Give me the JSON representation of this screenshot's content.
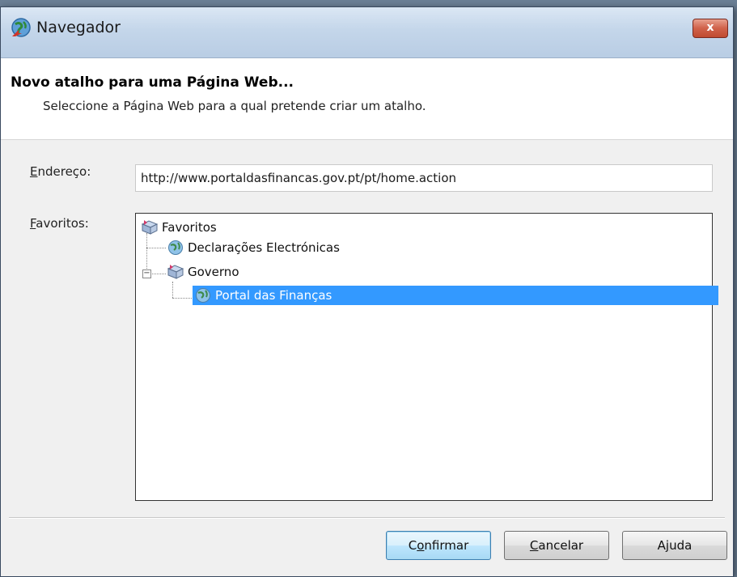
{
  "window": {
    "title": "Navegador",
    "close_label": "x"
  },
  "header": {
    "title": "Novo atalho para uma Página Web...",
    "subtitle": "Seleccione a Página Web para a qual pretende criar um atalho."
  },
  "form": {
    "address_label_prefix": "E",
    "address_label_rest": "ndereço:",
    "address_value": "http://www.portaldasfinancas.gov.pt/pt/home.action",
    "favorites_label_prefix": "F",
    "favorites_label_rest": "avoritos:"
  },
  "tree": {
    "root": {
      "label": "Favoritos",
      "icon": "favorites-folder-icon"
    },
    "item1": {
      "label": "Declarações Electrónicas",
      "icon": "globe-icon"
    },
    "folder": {
      "label": "Governo",
      "icon": "favorites-folder-icon",
      "expander": "−"
    },
    "item2": {
      "label": "Portal das Finanças",
      "icon": "globe-icon",
      "selected": true
    }
  },
  "buttons": {
    "confirm_pre": "C",
    "confirm_u": "o",
    "confirm_post": "nfirmar",
    "cancel_u": "C",
    "cancel_post": "ancelar",
    "help_pre": "A",
    "help_u": "j",
    "help_post": "uda"
  },
  "colors": {
    "selection": "#3399ff",
    "titlebar": "#c4d6ea",
    "close": "#c9513a"
  }
}
